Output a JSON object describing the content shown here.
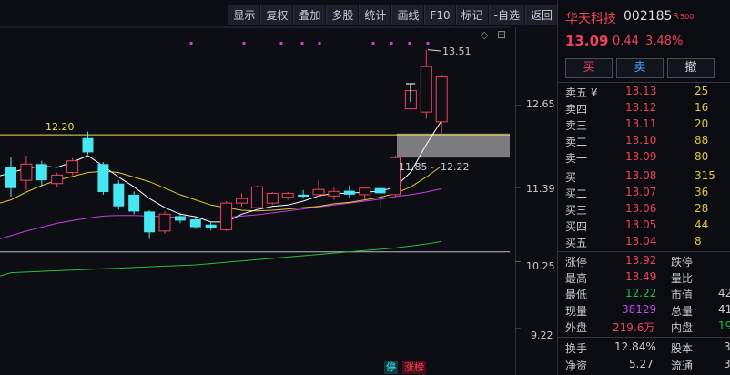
{
  "toolbar": {
    "buttons": [
      "显示",
      "复权",
      "叠加",
      "多股",
      "统计",
      "画线",
      "F10",
      "标记",
      "-自选",
      "返回"
    ]
  },
  "chart": {
    "price_labels": [
      "12.65",
      "11.39",
      "10.25",
      "9.22"
    ],
    "high_annotation": "13.51",
    "level_label": "12.20",
    "gap_low_label": "11.85",
    "gap_high_label": "12.22",
    "gap_separator": "-",
    "tags": [
      "停",
      "涨榜"
    ]
  },
  "chart_data": {
    "type": "candlestick",
    "y_labels": [
      12.65,
      11.39,
      10.25,
      9.22
    ],
    "candles": [
      {
        "o": 11.7,
        "c": 11.38,
        "h": 11.85,
        "l": 11.25
      },
      {
        "o": 11.5,
        "c": 11.75,
        "h": 11.88,
        "l": 11.35
      },
      {
        "o": 11.75,
        "c": 11.5,
        "h": 11.8,
        "l": 11.4
      },
      {
        "o": 11.45,
        "c": 11.58,
        "h": 11.62,
        "l": 11.4
      },
      {
        "o": 11.62,
        "c": 11.8,
        "h": 11.84,
        "l": 11.58
      },
      {
        "o": 12.15,
        "c": 11.93,
        "h": 12.25,
        "l": 11.9
      },
      {
        "o": 11.75,
        "c": 11.32,
        "h": 11.78,
        "l": 11.28
      },
      {
        "o": 11.45,
        "c": 11.1,
        "h": 11.5,
        "l": 11.05
      },
      {
        "o": 11.28,
        "c": 11.02,
        "h": 11.33,
        "l": 10.98
      },
      {
        "o": 11.02,
        "c": 10.7,
        "h": 11.04,
        "l": 10.6
      },
      {
        "o": 10.72,
        "c": 10.98,
        "h": 11.02,
        "l": 10.68
      },
      {
        "o": 10.95,
        "c": 10.88,
        "h": 11.0,
        "l": 10.84
      },
      {
        "o": 10.9,
        "c": 10.78,
        "h": 10.95,
        "l": 10.75
      },
      {
        "o": 10.82,
        "c": 10.77,
        "h": 10.86,
        "l": 10.73
      },
      {
        "o": 10.74,
        "c": 11.15,
        "h": 11.18,
        "l": 10.72
      },
      {
        "o": 11.15,
        "c": 11.22,
        "h": 11.3,
        "l": 11.1
      },
      {
        "o": 11.08,
        "c": 11.4,
        "h": 11.42,
        "l": 11.05
      },
      {
        "o": 11.15,
        "c": 11.3,
        "h": 11.32,
        "l": 11.12
      },
      {
        "o": 11.24,
        "c": 11.3,
        "h": 11.32,
        "l": 11.2
      },
      {
        "o": 11.28,
        "c": 11.25,
        "h": 11.35,
        "l": 11.22
      },
      {
        "o": 11.28,
        "c": 11.36,
        "h": 11.5,
        "l": 11.25
      },
      {
        "o": 11.26,
        "c": 11.33,
        "h": 11.4,
        "l": 11.2
      },
      {
        "o": 11.34,
        "c": 11.28,
        "h": 11.42,
        "l": 11.22
      },
      {
        "o": 11.28,
        "c": 11.38,
        "h": 11.4,
        "l": 11.2
      },
      {
        "o": 11.38,
        "c": 11.3,
        "h": 11.42,
        "l": 11.08
      },
      {
        "o": 11.28,
        "c": 11.85,
        "h": 11.88,
        "l": 11.26
      },
      {
        "o": 12.6,
        "c": 12.88,
        "h": 12.95,
        "l": 12.55
      },
      {
        "o": 12.55,
        "c": 13.25,
        "h": 13.51,
        "l": 12.45
      },
      {
        "o": 12.4,
        "c": 13.09,
        "h": 13.13,
        "l": 12.22
      }
    ],
    "ma5": [
      11.62,
      11.68,
      11.72,
      11.7,
      11.78,
      11.88,
      11.72,
      11.55,
      11.4,
      11.22,
      11.08,
      10.98,
      10.94,
      10.86,
      10.86,
      10.98,
      11.05,
      11.1,
      11.12,
      11.18,
      11.26,
      11.3,
      11.3,
      11.32,
      11.33,
      11.4,
      11.63,
      12.05,
      12.42
    ],
    "ma10": [
      11.2,
      11.32,
      11.42,
      11.5,
      11.56,
      11.62,
      11.64,
      11.62,
      11.55,
      11.48,
      11.38,
      11.28,
      11.2,
      11.12,
      11.08,
      11.04,
      11.03,
      11.04,
      11.06,
      11.08,
      11.1,
      11.14,
      11.16,
      11.2,
      11.24,
      11.3,
      11.4,
      11.55,
      11.72
    ],
    "ma20": [
      10.65,
      10.72,
      10.78,
      10.84,
      10.88,
      10.92,
      10.95,
      10.96,
      10.96,
      10.95,
      10.94,
      10.93,
      10.92,
      10.92,
      10.93,
      10.95,
      10.97,
      11.0,
      11.03,
      11.06,
      11.09,
      11.12,
      11.15,
      11.18,
      11.21,
      11.25,
      11.28,
      11.32,
      11.37
    ],
    "ma60": [
      10.08,
      10.09,
      10.1,
      10.11,
      10.12,
      10.13,
      10.14,
      10.15,
      10.16,
      10.17,
      10.18,
      10.19,
      10.2,
      10.22,
      10.24,
      10.26,
      10.28,
      10.3,
      10.32,
      10.34,
      10.36,
      10.38,
      10.4,
      10.42,
      10.44,
      10.46,
      10.49,
      10.52,
      10.56
    ],
    "level_line": 12.2,
    "support_line": 10.4,
    "gap_zone": [
      11.85,
      12.22
    ]
  },
  "quote": {
    "name": "华天科技",
    "code": "002185",
    "r_mark": "R",
    "r_value": "500",
    "price": "13.09",
    "change": "0.44",
    "change_pct": "3.48%",
    "buy_label": "买",
    "sell_label": "卖",
    "cancel_label": "撤",
    "asks": [
      {
        "label": "卖五 ¥",
        "price": "13.13",
        "vol": "25"
      },
      {
        "label": "卖四",
        "price": "13.12",
        "vol": "16"
      },
      {
        "label": "卖三",
        "price": "13.11",
        "vol": "20"
      },
      {
        "label": "卖二",
        "price": "13.10",
        "vol": "88"
      },
      {
        "label": "卖一",
        "price": "13.09",
        "vol": "80"
      }
    ],
    "bids": [
      {
        "label": "买一",
        "price": "13.08",
        "vol": "315"
      },
      {
        "label": "买二",
        "price": "13.07",
        "vol": "36"
      },
      {
        "label": "买三",
        "price": "13.06",
        "vol": "28"
      },
      {
        "label": "买四",
        "price": "13.05",
        "vol": "44"
      },
      {
        "label": "买五",
        "price": "13.04",
        "vol": "8"
      }
    ],
    "stats": {
      "limit_up_label": "涨停",
      "limit_up": "13.92",
      "limit_down_label": "跌停",
      "high_label": "最高",
      "high": "13.49",
      "vol_ratio_label": "量比",
      "low_label": "最低",
      "low": "12.22",
      "mkt_cap_label": "市值",
      "mkt_cap": "42",
      "volume_label": "现量",
      "volume": "38129",
      "total_label": "总量",
      "total": "41",
      "outer_label": "外盘",
      "outer": "219.6万",
      "inner_label": "内盘",
      "inner": "19",
      "turnover_label": "换手",
      "turnover": "12.84%",
      "equity_label": "股本",
      "equity": "3",
      "nav_label": "净资",
      "nav": "5.27",
      "float_label": "流通",
      "float": "3"
    }
  },
  "colors": {
    "up": "#f0425b",
    "down": "#46e6f2",
    "ma5": "#ffffff",
    "ma10": "#e6c62a",
    "ma20": "#c43fe0",
    "ma60": "#2bbb45",
    "level": "#e8e05a"
  }
}
